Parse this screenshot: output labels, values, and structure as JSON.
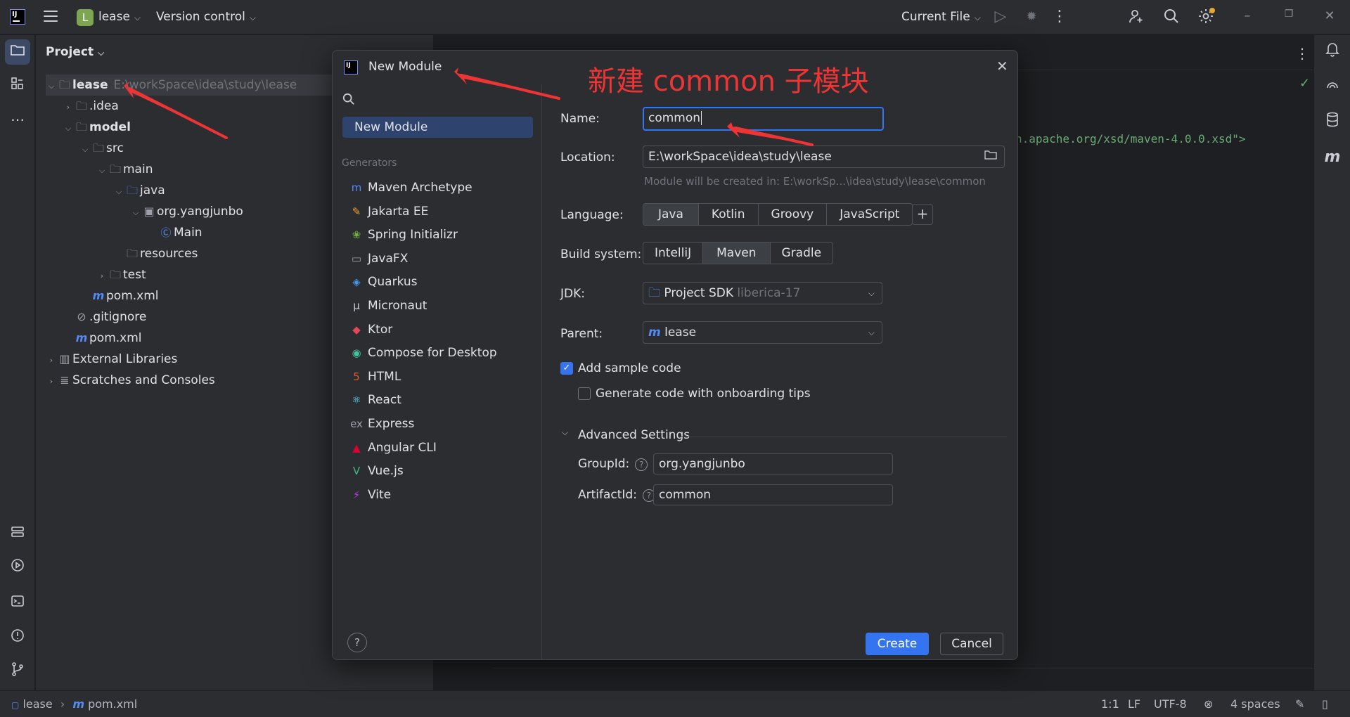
{
  "titlebar": {
    "logo": "IJ",
    "menu_icon": "hamburger-icon",
    "project_badge": "L",
    "project_name": "lease",
    "version_control": "Version control",
    "run_config": "Current File"
  },
  "left_strip": {
    "items": [
      "folder-icon",
      "structure-icon",
      "more-icon",
      "services-icon",
      "run-icon",
      "terminal-icon",
      "problems-icon",
      "git-icon"
    ]
  },
  "project_panel": {
    "title": "Project",
    "tree": [
      {
        "label": "lease",
        "path": "E:\\workSpace\\idea\\study\\lease"
      },
      {
        "label": ".idea"
      },
      {
        "label": "model"
      },
      {
        "label": "src"
      },
      {
        "label": "main"
      },
      {
        "label": "java"
      },
      {
        "label": "org.yangjunbo"
      },
      {
        "label": "Main"
      },
      {
        "label": "resources"
      },
      {
        "label": "test"
      },
      {
        "label": "pom.xml"
      },
      {
        "label": ".gitignore"
      },
      {
        "label": "pom.xml"
      },
      {
        "label": "External Libraries"
      },
      {
        "label": "Scratches and Consoles"
      }
    ]
  },
  "editor": {
    "code_fragment": "n.apache.org/xsd/maven-4.0.0.xsd\">"
  },
  "dialog": {
    "title": "New Module",
    "selected_item": "New Module",
    "generators_header": "Generators",
    "generators": [
      {
        "label": "Maven Archetype",
        "icon": "m",
        "color": "#548af7"
      },
      {
        "label": "Jakarta EE",
        "icon": "✎",
        "color": "#f0a030"
      },
      {
        "label": "Spring Initializr",
        "icon": "❀",
        "color": "#6db33f"
      },
      {
        "label": "JavaFX",
        "icon": "▭",
        "color": "#9da0a8"
      },
      {
        "label": "Quarkus",
        "icon": "◈",
        "color": "#4695eb"
      },
      {
        "label": "Micronaut",
        "icon": "μ",
        "color": "#c9ccd3"
      },
      {
        "label": "Ktor",
        "icon": "◆",
        "color": "#e44857"
      },
      {
        "label": "Compose for Desktop",
        "icon": "◉",
        "color": "#40c4a0"
      },
      {
        "label": "HTML",
        "icon": "5",
        "color": "#e4572e"
      },
      {
        "label": "React",
        "icon": "⚛",
        "color": "#61dafb"
      },
      {
        "label": "Express",
        "icon": "ex",
        "color": "#9da0a8"
      },
      {
        "label": "Angular CLI",
        "icon": "▲",
        "color": "#dd0031"
      },
      {
        "label": "Vue.js",
        "icon": "V",
        "color": "#41b883"
      },
      {
        "label": "Vite",
        "icon": "⚡",
        "color": "#bd34fe"
      }
    ],
    "form": {
      "name_label": "Name:",
      "name_value": "common",
      "location_label": "Location:",
      "location_value": "E:\\workSpace\\idea\\study\\lease",
      "location_hint": "Module will be created in: E:\\workSp...\\idea\\study\\lease\\common",
      "language_label": "Language:",
      "languages": [
        "Java",
        "Kotlin",
        "Groovy",
        "JavaScript"
      ],
      "language_selected": "Java",
      "build_label": "Build system:",
      "build_systems": [
        "IntelliJ",
        "Maven",
        "Gradle"
      ],
      "build_selected": "Maven",
      "jdk_label": "JDK:",
      "jdk_value": "Project SDK",
      "jdk_version": "liberica-17",
      "parent_label": "Parent:",
      "parent_value": "lease",
      "sample_code_label": "Add sample code",
      "sample_code_checked": true,
      "onboarding_label": "Generate code with onboarding tips",
      "onboarding_checked": false,
      "advanced_label": "Advanced Settings",
      "groupid_label": "GroupId:",
      "groupid_value": "org.yangjunbo",
      "artifactid_label": "ArtifactId:",
      "artifactid_value": "common"
    },
    "help": "?",
    "create_label": "Create",
    "cancel_label": "Cancel"
  },
  "status_bar": {
    "crumb_project": "lease",
    "crumb_file": "pom.xml",
    "position": "1:1",
    "line_sep": "LF",
    "encoding": "UTF-8",
    "indent": "4 spaces"
  },
  "annotation": {
    "text": "新建 common 子模块",
    "color": "#ee3434"
  }
}
